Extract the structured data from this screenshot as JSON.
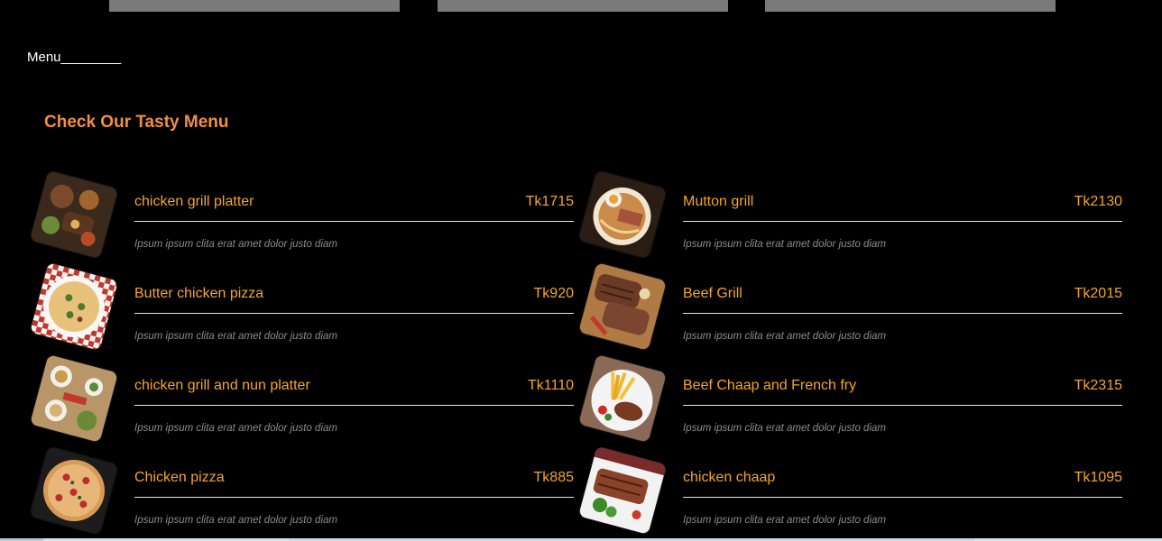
{
  "header": {
    "menu_label": "Menu________"
  },
  "section": {
    "heading": "Check Our Tasty Menu"
  },
  "colors": {
    "accent": "#f3903f",
    "item_text": "#f5a623",
    "desc_text": "#8c8c8c",
    "background": "#000000"
  },
  "menu_items": [
    {
      "name": "chicken grill platter",
      "price": "Tk1715",
      "description": "Ipsum ipsum clita erat amet dolor justo diam",
      "image_icon": "platter-photo"
    },
    {
      "name": "Mutton grill",
      "price": "Tk2130",
      "description": "Ipsum ipsum clita erat amet dolor justo diam",
      "image_icon": "ramen-photo"
    },
    {
      "name": "Butter chicken pizza",
      "price": "Tk920",
      "description": "Ipsum ipsum clita erat amet dolor justo diam",
      "image_icon": "pizza-photo"
    },
    {
      "name": "Beef Grill",
      "price": "Tk2015",
      "description": "Ipsum ipsum clita erat amet dolor justo diam",
      "image_icon": "steak-photo"
    },
    {
      "name": "chicken grill and nun platter",
      "price": "Tk1110",
      "description": "Ipsum ipsum clita erat amet dolor justo diam",
      "image_icon": "table-spread-photo"
    },
    {
      "name": "Beef Chaap and French fry",
      "price": "Tk2315",
      "description": "Ipsum ipsum clita erat amet dolor justo diam",
      "image_icon": "fries-plate-photo"
    },
    {
      "name": "Chicken pizza",
      "price": "Tk885",
      "description": "Ipsum ipsum clita erat amet dolor justo diam",
      "image_icon": "pizza-photo"
    },
    {
      "name": "chicken chaap",
      "price": "Tk1095",
      "description": "Ipsum ipsum clita erat amet dolor justo diam",
      "image_icon": "chaap-photo"
    }
  ]
}
